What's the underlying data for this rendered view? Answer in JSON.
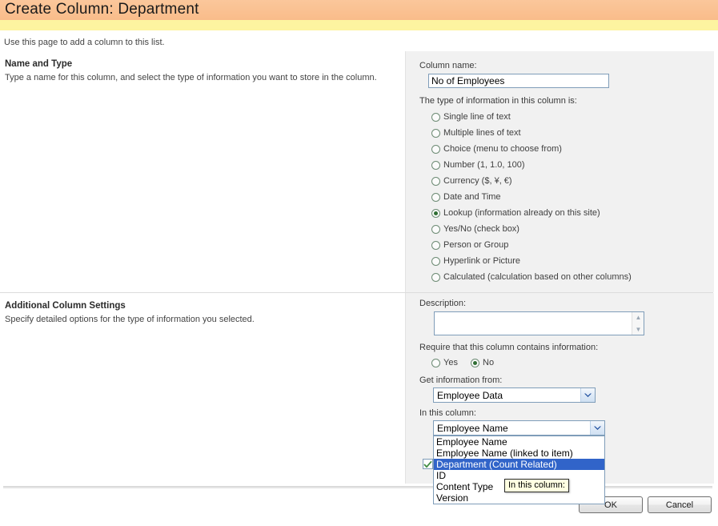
{
  "header": {
    "title": "Create Column: Department",
    "intro": "Use this page to add a column to this list."
  },
  "sections": [
    {
      "title": "Name and Type",
      "description": "Type a name for this column, and select the type of information you want to store in the column."
    },
    {
      "title": "Additional Column Settings",
      "description": "Specify detailed options for the type of information you selected."
    }
  ],
  "name_and_type": {
    "column_name_label": "Column name:",
    "column_name_value": "No of Employees",
    "type_label": "The type of information in this column is:",
    "type_options": [
      {
        "label": "Single line of text",
        "checked": false
      },
      {
        "label": "Multiple lines of text",
        "checked": false
      },
      {
        "label": "Choice (menu to choose from)",
        "checked": false
      },
      {
        "label": "Number (1, 1.0, 100)",
        "checked": false
      },
      {
        "label": "Currency ($, ¥, €)",
        "checked": false
      },
      {
        "label": "Date and Time",
        "checked": false
      },
      {
        "label": "Lookup (information already on this site)",
        "checked": true
      },
      {
        "label": "Yes/No (check box)",
        "checked": false
      },
      {
        "label": "Person or Group",
        "checked": false
      },
      {
        "label": "Hyperlink or Picture",
        "checked": false
      },
      {
        "label": "Calculated (calculation based on other columns)",
        "checked": false
      }
    ]
  },
  "additional_settings": {
    "description_label": "Description:",
    "description_value": "",
    "require_label": "Require that this column contains information:",
    "require_options": [
      {
        "label": "Yes",
        "checked": false
      },
      {
        "label": "No",
        "checked": true
      }
    ],
    "get_info_label": "Get information from:",
    "get_info_value": "Employee Data",
    "in_column_label": "In this column:",
    "in_column_value": "Employee Name",
    "in_column_options": [
      {
        "label": "Employee Name",
        "selected": false
      },
      {
        "label": "Employee Name (linked to item)",
        "selected": false
      },
      {
        "label": "Department (Count Related)",
        "selected": true
      },
      {
        "label": "ID",
        "selected": false
      },
      {
        "label": "Content Type",
        "selected": false
      },
      {
        "label": "Version",
        "selected": false
      }
    ],
    "related_checkbox_checked": true
  },
  "tooltip": {
    "text": "In this column:"
  },
  "footer": {
    "ok_label": "OK",
    "cancel_label": "Cancel"
  },
  "colors": {
    "title_bar": "#fac090",
    "accent_band": "#fdf4a0",
    "panel_gray": "#f1f1f1",
    "selection_blue": "#3164c9",
    "tooltip_bg": "#ffffe1"
  }
}
